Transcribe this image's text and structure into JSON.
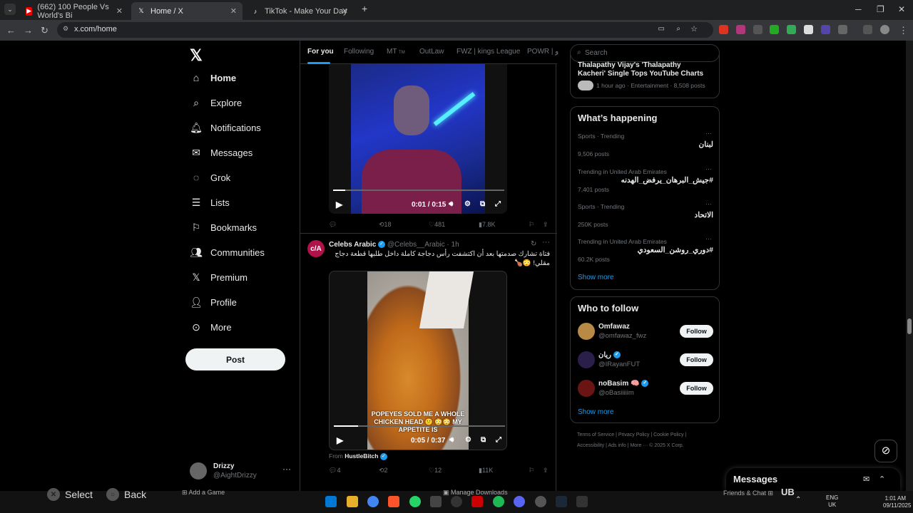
{
  "browser": {
    "tabs": [
      {
        "title": "(662) 100 People Vs World's Bi",
        "active": false,
        "favicon": "youtube-icon"
      },
      {
        "title": "Home / X",
        "active": true,
        "favicon": "x-logo-icon"
      },
      {
        "title": "TikTok - Make Your Day",
        "active": false,
        "favicon": "tiktok-icon"
      }
    ],
    "url": "x.com/home"
  },
  "sidebar": {
    "items": [
      {
        "label": "Home",
        "icon": "home-icon"
      },
      {
        "label": "Explore",
        "icon": "search-icon"
      },
      {
        "label": "Notifications",
        "icon": "bell-icon"
      },
      {
        "label": "Messages",
        "icon": "envelope-icon"
      },
      {
        "label": "Grok",
        "icon": "grok-icon"
      },
      {
        "label": "Lists",
        "icon": "list-icon"
      },
      {
        "label": "Bookmarks",
        "icon": "bookmark-icon"
      },
      {
        "label": "Communities",
        "icon": "people-icon"
      },
      {
        "label": "Premium",
        "icon": "x-logo-icon"
      },
      {
        "label": "Profile",
        "icon": "person-icon"
      },
      {
        "label": "More",
        "icon": "more-circle-icon"
      }
    ],
    "post_label": "Post",
    "account": {
      "name": "Drizzy",
      "handle": "@AightDrizzy"
    }
  },
  "feed": {
    "tabs": [
      "For you",
      "Following",
      "MT",
      "OutLaw",
      "FWZ | kings League",
      "POWR | ﻭ"
    ],
    "tab_extra": "TM",
    "post1": {
      "time": "0:01 / 0:15",
      "progress": 0.07,
      "replies": "",
      "reposts": "18",
      "likes": "481",
      "views": "7.8K"
    },
    "post2": {
      "author": "Celebs Arabic",
      "handle": "@Celebs__Arabic · 1h",
      "avatar_text": "c/A",
      "text": "فتاة تشارك صدمتها بعد أن اكتشفت رأس دجاجة كاملة داخل طلبها قطعة دجاج مقلي! 😳🍗",
      "caption": "POPEYES SOLD ME A WHOLE CHICKEN HEAD 😕 😳😳 MY APPETITE IS",
      "time": "0:05 / 0:37",
      "progress": 0.14,
      "from_label": "From",
      "from_user": "HustleBitch",
      "replies": "4",
      "reposts": "2",
      "likes": "12",
      "views": "11K"
    }
  },
  "right": {
    "search_placeholder": "Search",
    "news": {
      "title": "Thalapathy Vijay's 'Thalapathy Kacheri' Single Tops YouTube Charts",
      "meta": "1 hour ago · Entertainment · 8,508 posts"
    },
    "whats_happening": "What’s happening",
    "trends": [
      {
        "context": "Sports · Trending",
        "name": "لبنان",
        "posts": "9,506 posts"
      },
      {
        "context": "Trending in United Arab Emirates",
        "name": "#جيش_البرهان_يرفض_الهدنه",
        "posts": "7,401 posts"
      },
      {
        "context": "Sports · Trending",
        "name": "الاتحاد",
        "posts": "250K posts"
      },
      {
        "context": "Trending in United Arab Emirates",
        "name": "#دوري_روشن_السعودي",
        "posts": "60.2K posts"
      }
    ],
    "show_more": "Show more",
    "who_to_follow": "Who to follow",
    "follow_suggestions": [
      {
        "name": "Omfawaz",
        "handle": "@omfawaz_fwz",
        "verified": false,
        "avatar_color": "#b88a45"
      },
      {
        "name": "ريان",
        "handle": "@IRayanFUT",
        "verified": true,
        "avatar_color": "#2a1f4a"
      },
      {
        "name": "noBasim 🧠",
        "handle": "@oBasiiiiim",
        "verified": true,
        "avatar_color": "#6b1414"
      }
    ],
    "follow_label": "Follow",
    "footer_line1": "Terms of Service  |  Privacy Policy  |  Cookie Policy  |",
    "footer_line2": "Accessibility  |  Ads info  |  More ···  © 2025 X Corp."
  },
  "messages_dock": "Messages",
  "overlay": {
    "select_label": "Select",
    "back_label": "Back",
    "add_game": "Add a Game",
    "manage_downloads": "Manage Downloads",
    "friends_chat": "Friends & Chat",
    "lang": "ENG\nUK",
    "time": "1:01 AM",
    "date": "09/11/2025"
  },
  "colors": {
    "accent": "#1d9bf0",
    "background": "#000000",
    "border": "#2f3336"
  }
}
